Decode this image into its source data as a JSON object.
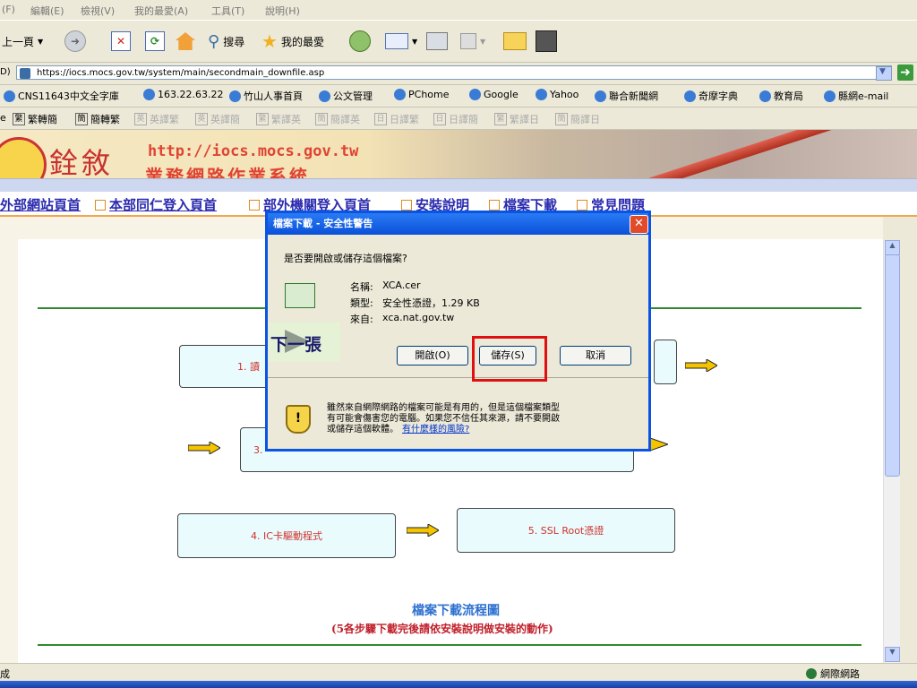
{
  "menu": [
    "(F)",
    "編輯(E)",
    "檢視(V)",
    "我的最愛(A)",
    "工具(T)",
    "說明(H)"
  ],
  "toolbar": {
    "back_label": "上一頁",
    "search_label": "搜尋",
    "favorites_label": "我的最愛"
  },
  "address": {
    "prefix": "D)",
    "url": "https://iocs.mocs.gov.tw/system/main/secondmain_downfile.asp"
  },
  "links_bar": [
    "CNS11643中文全字庫",
    "163.22.63.22",
    "竹山人事首頁",
    "公文管理",
    "PChome",
    "Google",
    "Yahoo",
    "聯合新聞網",
    "奇摩字典",
    "教育局",
    "縣網e-mail"
  ],
  "translate_bar": [
    {
      "icon": "繁",
      "label": "繁轉簡",
      "enabled": true
    },
    {
      "icon": "簡",
      "label": "簡轉繁",
      "enabled": true
    },
    {
      "icon": "英",
      "label": "英譯繁",
      "enabled": false
    },
    {
      "icon": "英",
      "label": "英譯簡",
      "enabled": false
    },
    {
      "icon": "繁",
      "label": "繁譯英",
      "enabled": false
    },
    {
      "icon": "簡",
      "label": "簡譯英",
      "enabled": false
    },
    {
      "icon": "日",
      "label": "日譯繁",
      "enabled": false
    },
    {
      "icon": "日",
      "label": "日譯簡",
      "enabled": false
    },
    {
      "icon": "繁",
      "label": "繁譯日",
      "enabled": false
    },
    {
      "icon": "簡",
      "label": "簡譯日",
      "enabled": false
    }
  ],
  "banner": {
    "title": "銓敘",
    "url": "http://iocs.mocs.gov.tw",
    "subtitle": "業務網路作業系統"
  },
  "nav": [
    "外部網站頁首",
    "本部同仁登入頁首",
    "部外機關登入頁首",
    "安裝說明",
    "檔案下載",
    "常見問題"
  ],
  "flow": {
    "step1": "1. 讀",
    "step3": "3.",
    "step4": "4. IC卡驅動程式",
    "step5": "5. SSL Root憑證",
    "title": "檔案下載流程圖",
    "subtitle": "(5各步驟下載完後請依安裝說明做安裝的動作)"
  },
  "dialog": {
    "title": "檔案下載 - 安全性警告",
    "question": "是否要開啟或儲存這個檔案?",
    "name_label": "名稱:",
    "name_value": "XCA.cer",
    "type_label": "類型:",
    "type_value": "安全性憑證，1.29 KB",
    "from_label": "來自:",
    "from_value": "xca.nat.gov.tw",
    "open_btn": "開啟(O)",
    "save_btn": "儲存(S)",
    "cancel_btn": "取消",
    "warning_line1": "雖然來自網際網路的檔案可能是有用的，但是這個檔案類型",
    "warning_line2": "有可能會傷害您的電腦。如果您不信任其來源，請不要開啟",
    "warning_line3": "或儲存這個軟體。",
    "risk_link": "有什麼樣的風險?"
  },
  "overlay": {
    "next_label": "下一張"
  },
  "status": {
    "left": "成",
    "zone": "網際網路"
  }
}
